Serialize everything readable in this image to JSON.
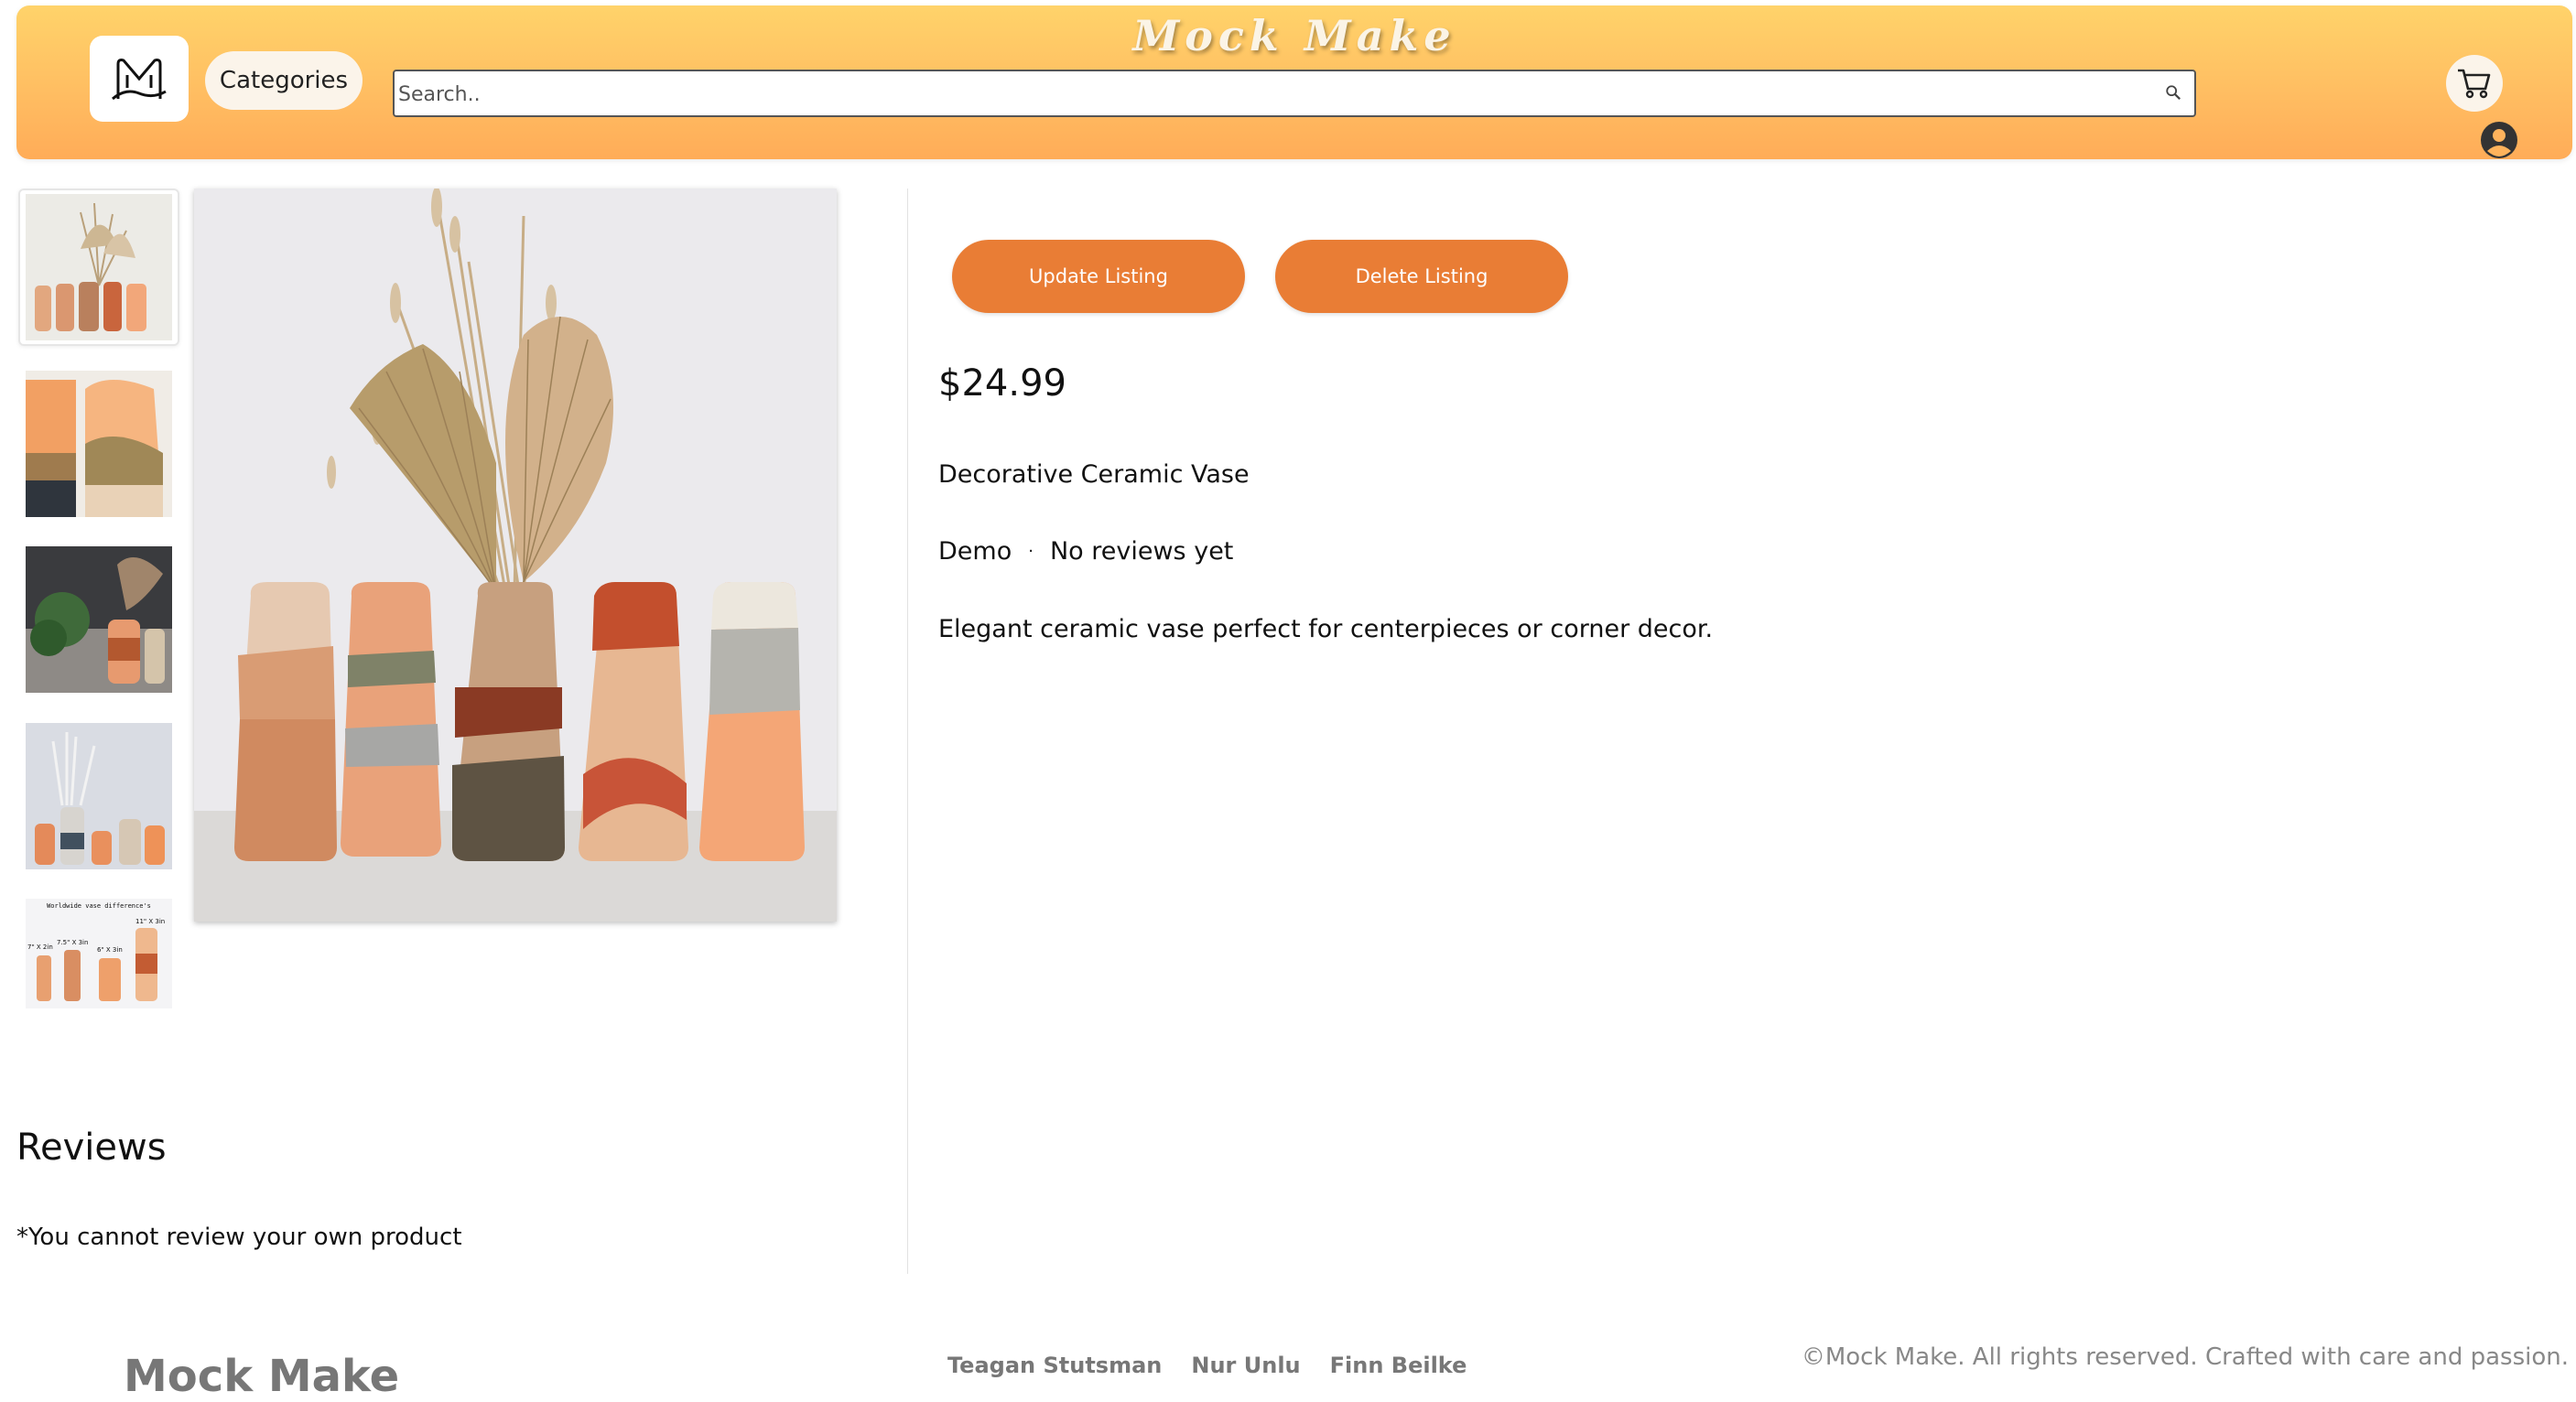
{
  "header": {
    "brand": "Mock Make",
    "categories_label": "Categories",
    "search_placeholder": "Search..",
    "accent": "#ffbe62"
  },
  "gallery": {
    "thumbnails": [
      "vase-set-with-dried-flowers",
      "vase-closeup-pair",
      "vase-with-plant",
      "vase-row-white-decor",
      "size-chart"
    ],
    "size_chart": {
      "heading": "Worldwide vase difference's",
      "labels": [
        "7\" X 2in",
        "7.5\" X 3in",
        "6\" X 3in",
        "11\" X 3in"
      ]
    },
    "main_image": "vase-set-with-dried-flowers"
  },
  "listing": {
    "update_label": "Update Listing",
    "delete_label": "Delete Listing",
    "button_color": "#e97d35",
    "price": "$24.99",
    "title": "Decorative Ceramic Vase",
    "seller": "Demo",
    "separator": "·",
    "reviews_status": "No reviews yet",
    "description": "Elegant ceramic vase perfect for centerpieces or corner decor."
  },
  "reviews": {
    "title": "Reviews",
    "note": "*You cannot review your own product"
  },
  "footer": {
    "brand": "Mock Make",
    "credits": [
      "Teagan Stutsman",
      "Nur Unlu",
      "Finn Beilke"
    ],
    "copyright": "©Mock Make. All rights reserved. Crafted with care and passion."
  }
}
